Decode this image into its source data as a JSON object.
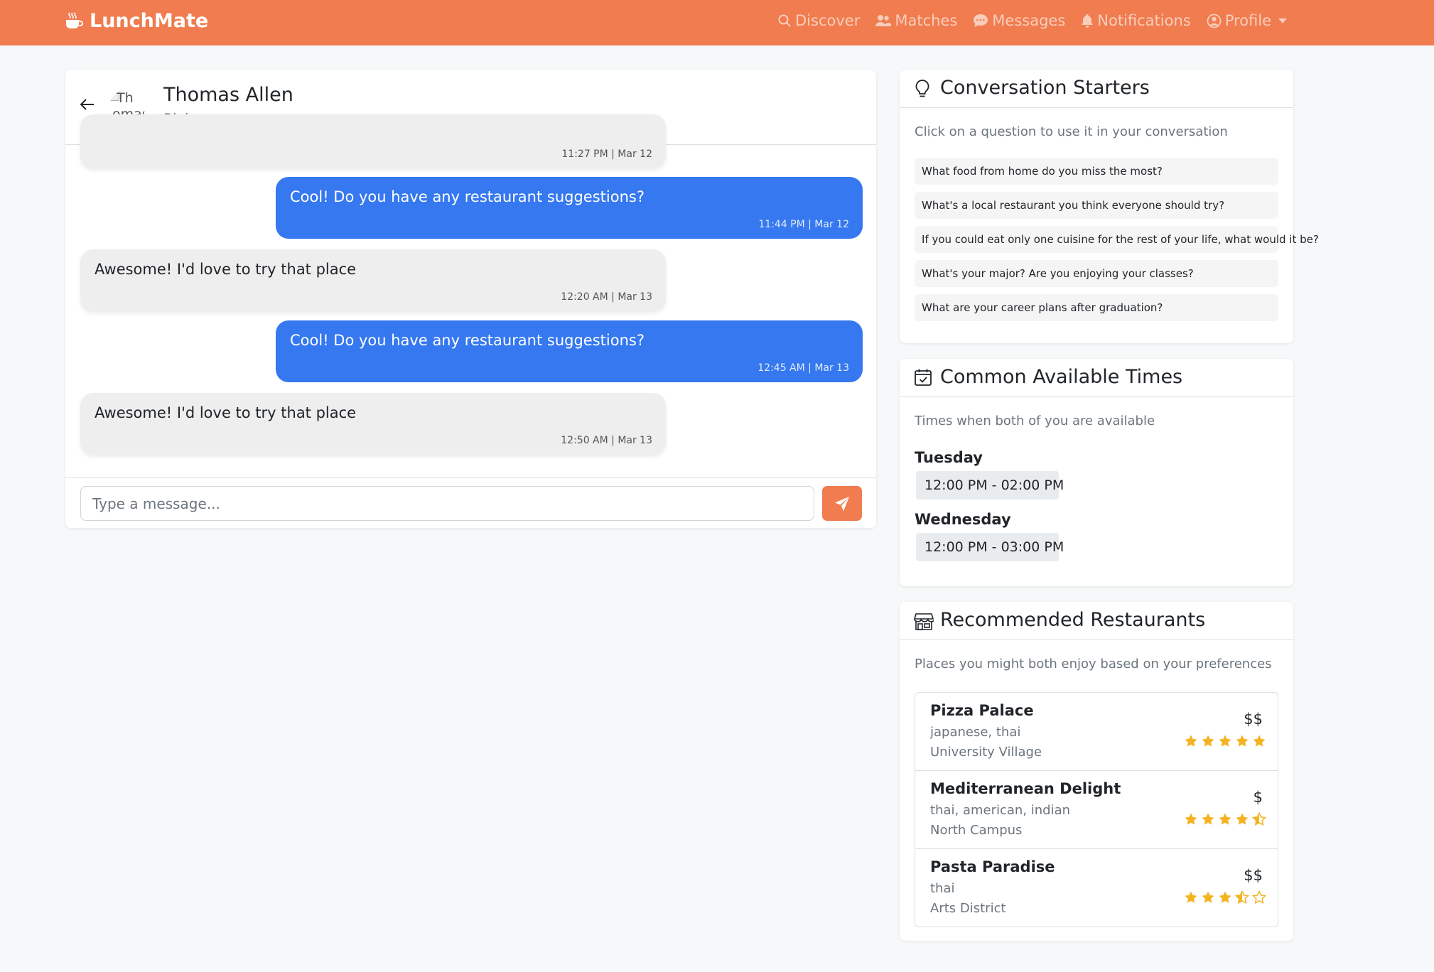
{
  "app": {
    "brand": "LunchMate",
    "accent_color": "#f07c4f",
    "nav": [
      {
        "label": "Discover",
        "icon": "search-icon"
      },
      {
        "label": "Matches",
        "icon": "people-icon"
      },
      {
        "label": "Messages",
        "icon": "chat-icon"
      },
      {
        "label": "Notifications",
        "icon": "bell-icon"
      },
      {
        "label": "Profile",
        "icon": "user-circle-icon"
      }
    ]
  },
  "chat": {
    "contact": {
      "name": "Thomas Allen",
      "subtitle": "Biology",
      "avatar_alt_line1": "Th",
      "avatar_alt_line2": "omas"
    },
    "messages": [
      {
        "direction": "in",
        "text": "",
        "time": "11:27 PM | Mar 12"
      },
      {
        "direction": "out",
        "text": "Cool! Do you have any restaurant suggestions?",
        "time": "11:44 PM | Mar 12"
      },
      {
        "direction": "in",
        "text": "Awesome! I'd love to try that place",
        "time": "12:20 AM | Mar 13"
      },
      {
        "direction": "out",
        "text": "Cool! Do you have any restaurant suggestions?",
        "time": "12:45 AM | Mar 13"
      },
      {
        "direction": "in",
        "text": "Awesome! I'd love to try that place",
        "time": "12:50 AM | Mar 13"
      }
    ],
    "input_placeholder": "Type a message..."
  },
  "starters": {
    "title": "Conversation Starters",
    "description": "Click on a question to use it in your conversation",
    "questions": [
      "What food from home do you miss the most?",
      "What's a local restaurant you think everyone should try?",
      "If you could eat only one cuisine for the rest of your life, what would it be?",
      "What's your major? Are you enjoying your classes?",
      "What are your career plans after graduation?"
    ]
  },
  "times": {
    "title": "Common Available Times",
    "description": "Times when both of you are available",
    "days": [
      {
        "day": "Tuesday",
        "slot": "12:00 PM - 02:00 PM"
      },
      {
        "day": "Wednesday",
        "slot": "12:00 PM - 03:00 PM"
      }
    ]
  },
  "restaurants": {
    "title": "Recommended Restaurants",
    "description": "Places you might both enjoy based on your preferences",
    "star_color": "#f4b321",
    "items": [
      {
        "name": "Pizza Palace",
        "cuisine": "japanese, thai",
        "area": "University Village",
        "price": "$$",
        "rating": 5
      },
      {
        "name": "Mediterranean Delight",
        "cuisine": "thai, american, indian",
        "area": "North Campus",
        "price": "$",
        "rating": 4.5
      },
      {
        "name": "Pasta Paradise",
        "cuisine": "thai",
        "area": "Arts District",
        "price": "$$",
        "rating": 3.5
      }
    ]
  }
}
